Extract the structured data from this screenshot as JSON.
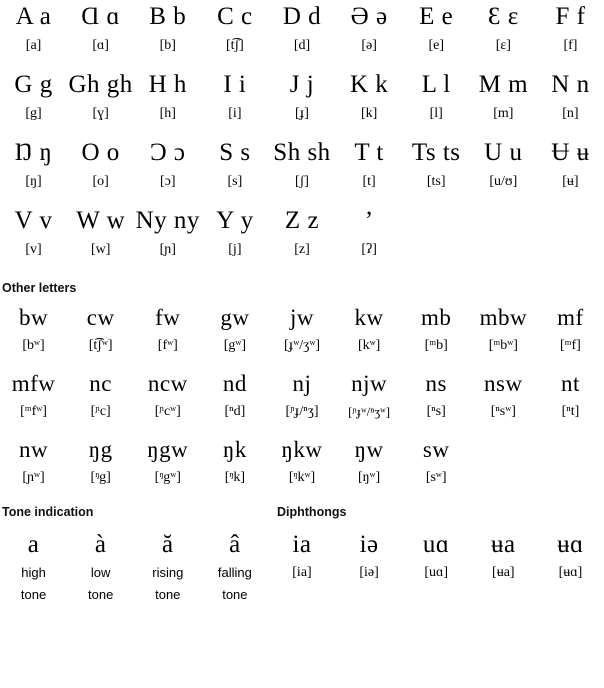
{
  "alphabet": {
    "rows": [
      {
        "letters": [
          "A a",
          "Ɑ ɑ",
          "B b",
          "C c",
          "D d",
          "Ə ə",
          "E e",
          "Ɛ ɛ",
          "F f"
        ],
        "ipa": [
          "[a]",
          "[ɑ]",
          "[b]",
          "[t͡ʃ]",
          "[d]",
          "[ə]",
          "[e]",
          "[ɛ]",
          "[f]"
        ]
      },
      {
        "letters": [
          "G g",
          "Gh gh",
          "H h",
          "I i",
          "J j",
          "K k",
          "L l",
          "M m",
          "N n"
        ],
        "ipa": [
          "[g]",
          "[ɣ]",
          "[h]",
          "[i]",
          "[ɟ]",
          "[k]",
          "[l]",
          "[m]",
          "[n]"
        ]
      },
      {
        "letters": [
          "Ŋ ŋ",
          "O o",
          "Ɔ ɔ",
          "S s",
          "Sh sh",
          "T t",
          "Ts ts",
          "U u",
          "Ʉ ʉ"
        ],
        "ipa": [
          "[ŋ]",
          "[o]",
          "[ɔ]",
          "[s]",
          "[ʃ]",
          "[t]",
          "[ts]",
          "[u/ʊ]",
          "[ʉ]"
        ]
      },
      {
        "letters": [
          "V v",
          "W w",
          "Ny ny",
          "Y y",
          "Z z",
          "’",
          "",
          "",
          ""
        ],
        "ipa": [
          "[v]",
          "[w]",
          "[ɲ]",
          "[j]",
          "[z]",
          "[ʔ]",
          "",
          "",
          ""
        ]
      }
    ]
  },
  "other_letters": {
    "heading": "Other letters",
    "rows": [
      {
        "letters": [
          "bw",
          "cw",
          "fw",
          "gw",
          "jw",
          "kw",
          "mb",
          "mbw",
          "mf"
        ],
        "ipa": [
          "[bʷ]",
          "[t͡ʃʷ]",
          "[fʷ]",
          "[gʷ]",
          "[ɟʷ/ʒʷ]",
          "[kʷ]",
          "[ᵐb]",
          "[ᵐbʷ]",
          "[ᵐf]"
        ]
      },
      {
        "letters": [
          "mfw",
          "nc",
          "ncw",
          "nd",
          "nj",
          "njw",
          "ns",
          "nsw",
          "nt"
        ],
        "ipa": [
          "[ᵐfʷ]",
          "[ᶮc]",
          "[ᶮcʷ]",
          "[ⁿd]",
          "[ᶮɟ/ⁿʒ]",
          "[ᶮɟʷ/ⁿʒʷ]",
          "[ⁿs]",
          "[ⁿsʷ]",
          "[ⁿt]"
        ]
      },
      {
        "letters": [
          "nw",
          "ŋg",
          "ŋgw",
          "ŋk",
          "ŋkw",
          "ŋw",
          "sw",
          "",
          ""
        ],
        "ipa": [
          "[ɲʷ]",
          "[ᵑg]",
          "[ᵑgʷ]",
          "[ᵑk]",
          "[ᵑkʷ]",
          "[ŋʷ]",
          "[sʷ]",
          "",
          ""
        ]
      }
    ]
  },
  "tone": {
    "heading": "Tone indication",
    "marks": [
      "a",
      "à",
      "ă",
      "â"
    ],
    "labels_line1": [
      "high",
      "low",
      "rising",
      "falling"
    ],
    "labels_line2": [
      "tone",
      "tone",
      "tone",
      "tone"
    ]
  },
  "diphthongs": {
    "heading": "Diphthongs",
    "letters": [
      "ia",
      "iə",
      "uɑ",
      "ʉa",
      "ʉɑ"
    ],
    "ipa": [
      "[ia]",
      "[iə]",
      "[uɑ]",
      "[ʉa]",
      "[ʉɑ]"
    ]
  }
}
